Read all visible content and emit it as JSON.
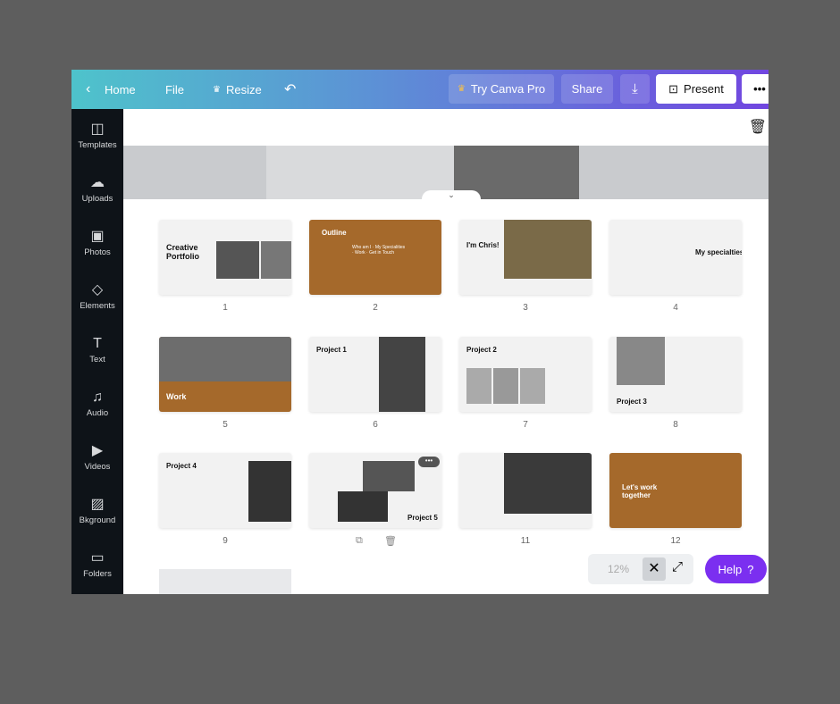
{
  "topbar": {
    "home": "Home",
    "file": "File",
    "resize": "Resize",
    "try_pro": "Try Canva Pro",
    "share": "Share",
    "present": "Present",
    "more": "•••"
  },
  "sidebar": [
    {
      "label": "Templates",
      "icon": "◫"
    },
    {
      "label": "Uploads",
      "icon": "☁"
    },
    {
      "label": "Photos",
      "icon": "▣"
    },
    {
      "label": "Elements",
      "icon": "◇"
    },
    {
      "label": "Text",
      "icon": "T"
    },
    {
      "label": "Audio",
      "icon": "♫"
    },
    {
      "label": "Videos",
      "icon": "▶"
    },
    {
      "label": "Bkground",
      "icon": "▨"
    },
    {
      "label": "Folders",
      "icon": "▭"
    }
  ],
  "pages": [
    {
      "n": "1",
      "title": "Creative Portfolio",
      "style": "light"
    },
    {
      "n": "2",
      "title": "Outline",
      "items": "Who am I · My Specialities · Work · Get in Touch",
      "style": "brown"
    },
    {
      "n": "3",
      "title": "I'm Chris!",
      "style": "light"
    },
    {
      "n": "4",
      "title": "My specialties",
      "style": "light"
    },
    {
      "n": "5",
      "title": "Work",
      "style": "brown"
    },
    {
      "n": "6",
      "title": "Project 1",
      "style": "light"
    },
    {
      "n": "7",
      "title": "Project 2",
      "style": "light"
    },
    {
      "n": "8",
      "title": "Project 3",
      "style": "light"
    },
    {
      "n": "9",
      "title": "Project 4",
      "style": "light"
    },
    {
      "n": "",
      "title": "Project 5",
      "style": "light"
    },
    {
      "n": "11",
      "title": "",
      "style": "light"
    },
    {
      "n": "12",
      "title": "Let's work together",
      "style": "brown"
    }
  ],
  "zoom": {
    "value": "12%"
  },
  "help": {
    "label": "Help",
    "icon": "?"
  },
  "colors": {
    "accent": "#7b2ff0",
    "brown": "#a5692b",
    "sidebar": "#0e1318"
  }
}
